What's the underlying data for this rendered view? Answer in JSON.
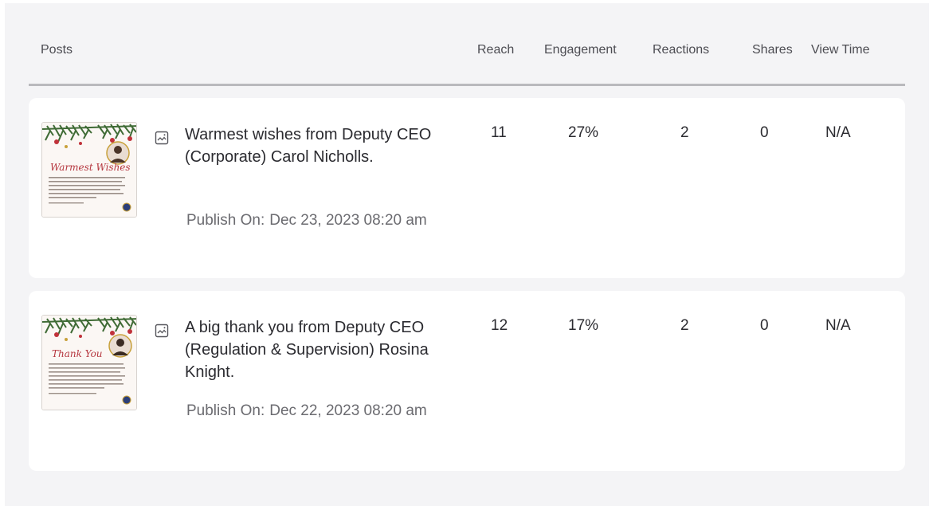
{
  "table": {
    "columns": {
      "posts": "Posts",
      "reach": "Reach",
      "engagement": "Engagement",
      "reactions": "Reactions",
      "shares": "Shares",
      "view_time": "View Time"
    },
    "publish_label": "Publish On:",
    "rows": [
      {
        "title": "Warmest wishes from Deputy CEO (Corporate) Carol Nicholls.",
        "publish_date": "Dec 23, 2023 08:20 am",
        "reach": "11",
        "engagement": "27%",
        "reactions": "2",
        "shares": "0",
        "view_time": "N/A",
        "thumbnail": {
          "heading": "Warmest Wishes",
          "body": "\"Looking ahead to the new year, we are filled with optimism and excitement for what we can achieve together. I have no doubt that with our collective efforts, we will continue to innovate, grow, and make a positive impact locally, regionally, and across the world.\"",
          "signature": "- Deputy CEO (Corporate) Carol Nicholls"
        },
        "type_icon": "image-icon"
      },
      {
        "title": "A big thank you from Deputy CEO (Regulation & Supervision) Rosina Knight.",
        "publish_date": "Dec 22, 2023 08:20 am",
        "reach": "12",
        "engagement": "17%",
        "reactions": "2",
        "shares": "0",
        "view_time": "N/A",
        "thumbnail": {
          "heading": "Thank You",
          "body": "\"To you, our valued stakeholders, your cooperation, feedback, and all-round support make our role possible and meaningful. Whether you are among those entities that have long been a part of our financial landscape, or you made Barbados your home over the course of this year, we say thank you for helping Barbados as an attractive and formidable destination for doing business.\"",
          "signature": "- Deputy CEO (Regulation & Supervision) Rosina Knight"
        },
        "type_icon": "image-icon"
      }
    ]
  },
  "colors": {
    "panel_bg": "#f4f4f6",
    "card_bg": "#ffffff",
    "header_rule": "#b9b9bd",
    "thumb_script": "#b5363e",
    "pine": "#3f6b35"
  }
}
